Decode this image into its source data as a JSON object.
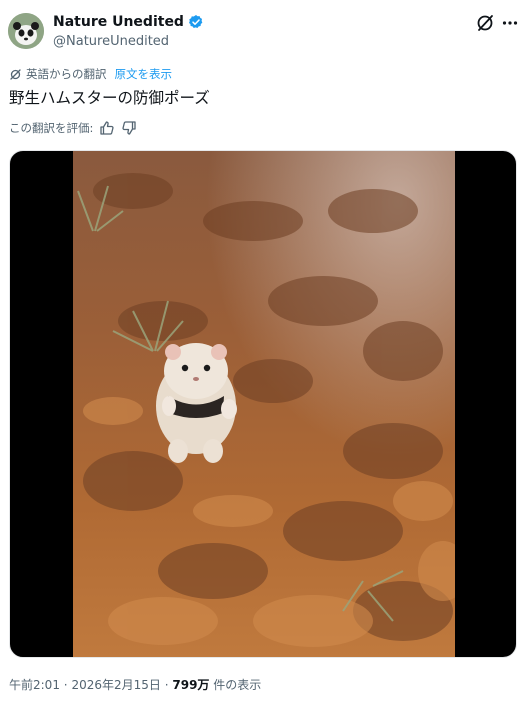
{
  "author": {
    "display_name": "Nature Unedited",
    "handle": "@NatureUnedited",
    "verified": true,
    "avatar_icon": "panda-avatar"
  },
  "header_actions": {
    "grok_icon": "grok-icon",
    "more_icon": "more-icon"
  },
  "translation": {
    "notice": "英語からの翻訳",
    "show_original": "原文を表示"
  },
  "tweet": {
    "text": "野生ハムスターの防御ポーズ"
  },
  "rate_translation": {
    "label": "この翻訳を評価:"
  },
  "media": {
    "type": "video"
  },
  "meta": {
    "time": "午前2:01",
    "separator": "·",
    "date": "2026年2月15日",
    "views_count": "799万",
    "views_label": "件の表示"
  },
  "colors": {
    "link": "#1d9bf0",
    "secondary_text": "#536471",
    "primary_text": "#0f1419"
  }
}
